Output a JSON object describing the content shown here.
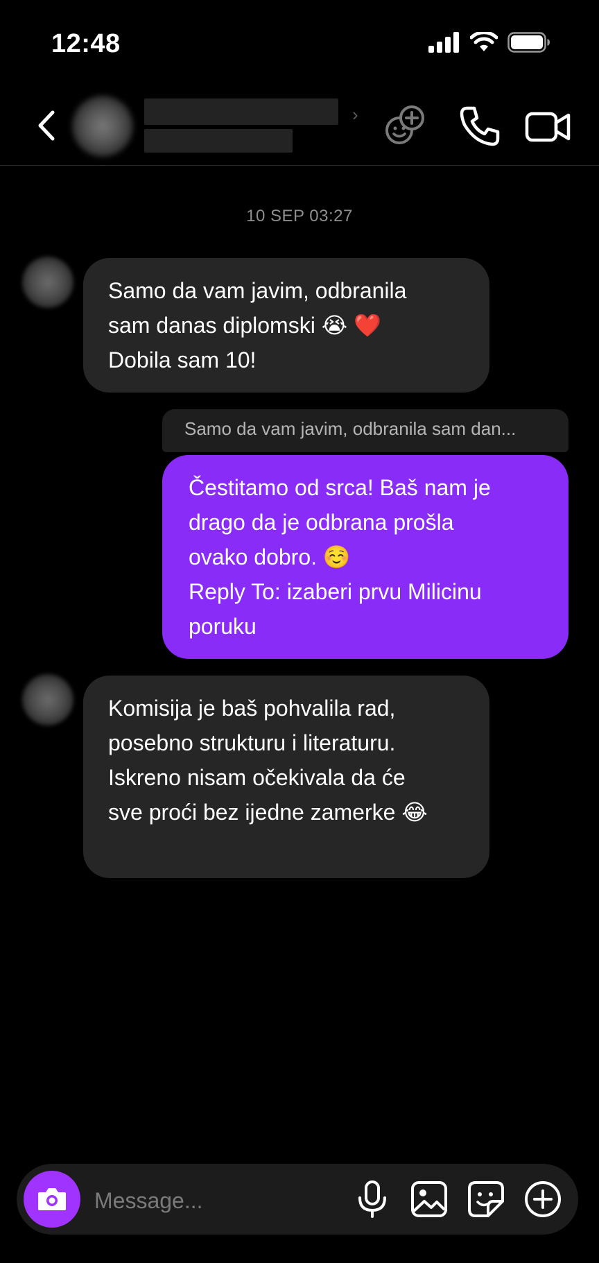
{
  "status_bar": {
    "time": "12:48",
    "icons": [
      "signal-icon",
      "wifi-icon",
      "battery-icon"
    ]
  },
  "header": {
    "icons": [
      "add-people-icon",
      "phone-icon",
      "video-icon"
    ]
  },
  "conversation": {
    "timestamp": "10 SEP 03:27",
    "messages": [
      {
        "direction": "incoming",
        "lines": [
          "Samo da vam javim, odbranila",
          "sam danas diplomski 😭 ❤️",
          "Dobila sam 10!"
        ]
      },
      {
        "direction": "outgoing",
        "reply_preview": "Samo da vam javim, odbranila sam dan...",
        "lines": [
          "Čestitamo od srca! Baš nam je",
          "drago da je odbrana prošla",
          "ovako dobro. ☺️",
          "Reply To: izaberi prvu Milicinu",
          "poruku"
        ]
      },
      {
        "direction": "incoming",
        "lines": [
          "Komisija je baš pohvalila rad,",
          "posebno strukturu i literaturu.",
          "Iskreno nisam očekivala da će",
          "sve proći bez ijedne zamerke 😂"
        ]
      }
    ]
  },
  "composer": {
    "placeholder": "Message...",
    "icons": [
      "camera-icon",
      "microphone-icon",
      "gallery-icon",
      "sticker-icon",
      "plus-icon"
    ]
  },
  "colors": {
    "background": "#000000",
    "incoming_bubble": "#262626",
    "outgoing_bubble": "#8a2cf7",
    "camera_button": "#a033ff"
  }
}
